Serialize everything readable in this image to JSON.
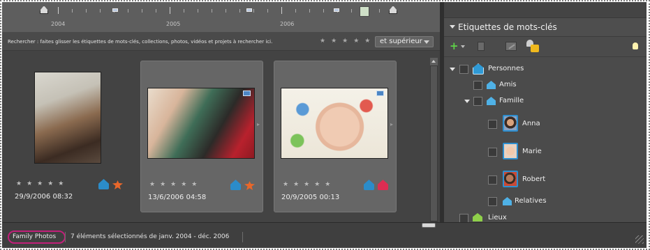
{
  "timeline": {
    "years": [
      "2004",
      "2005",
      "2006"
    ]
  },
  "search": {
    "hint": "Rechercher : faites glisser les étiquettes de mots-clés, collections, photos, vidéos et projets à rechercher ici.",
    "rating_stars": "★★★★★",
    "rating_filter": "et supérieur"
  },
  "media": [
    {
      "date": "29/9/2006 08:32",
      "stars": "★★★★★",
      "selected": false,
      "video_badge": false,
      "tags": [
        "person-tag-icon",
        "favorite-tag-icon"
      ]
    },
    {
      "date": "13/6/2006 04:58",
      "stars": "★★★★★",
      "selected": true,
      "video_badge": true,
      "tags": [
        "person-tag-icon",
        "favorite-tag-icon"
      ]
    },
    {
      "date": "20/9/2005 00:13",
      "stars": "★★★★★",
      "selected": true,
      "video_badge": true,
      "tags": [
        "person-tag-icon",
        "red-tag-icon"
      ]
    }
  ],
  "panel": {
    "title": "Etiquettes de mots-clés",
    "tree": [
      {
        "label": "Personnes",
        "type": "category"
      },
      {
        "label": "Amis",
        "type": "subcategory"
      },
      {
        "label": "Famille",
        "type": "subcategory"
      },
      {
        "label": "Anna",
        "type": "person"
      },
      {
        "label": "Marie",
        "type": "person"
      },
      {
        "label": "Robert",
        "type": "person"
      },
      {
        "label": "Relatives",
        "type": "subcategory"
      },
      {
        "label": "Lieux",
        "type": "category"
      }
    ]
  },
  "status": {
    "album": "Family Photos",
    "selection_text": "7 éléments sélectionnés de janv. 2004 - déc. 2006"
  },
  "colors": {
    "highlight_pill": "#c21f7a",
    "add_green": "#5fd348",
    "tag_blue": "#2f9ad6"
  }
}
